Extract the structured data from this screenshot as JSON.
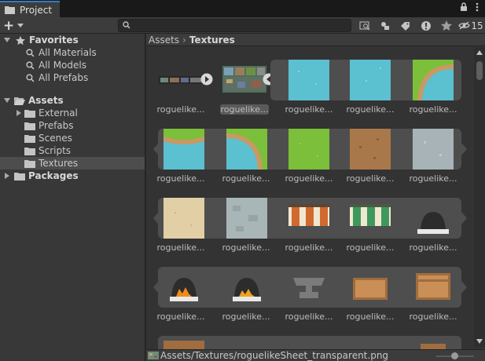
{
  "window": {
    "tab_title": "Project"
  },
  "toolbar": {
    "add_label": "+",
    "search_placeholder": "",
    "hidden_count": "15"
  },
  "tree": {
    "favorites": {
      "label": "Favorites",
      "items": [
        "All Materials",
        "All Models",
        "All Prefabs"
      ]
    },
    "assets": {
      "label": "Assets",
      "items": [
        "External",
        "Prefabs",
        "Scenes",
        "Scripts",
        "Textures"
      ],
      "selected": "Textures"
    },
    "packages": {
      "label": "Packages"
    }
  },
  "breadcrumb": {
    "root": "Assets",
    "current": "Textures"
  },
  "grid": {
    "captions": [
      [
        "roguelike...",
        "roguelike...",
        "roguelike...",
        "roguelike...",
        "roguelike..."
      ],
      [
        "roguelike...",
        "roguelike...",
        "roguelike...",
        "roguelike...",
        "roguelike..."
      ],
      [
        "roguelike...",
        "roguelike...",
        "roguelike...",
        "roguelike...",
        "roguelike..."
      ],
      [
        "roguelike...",
        "roguelike...",
        "roguelike...",
        "roguelike...",
        "roguelike..."
      ]
    ]
  },
  "status": {
    "path": "Assets/Textures/roguelikeSheet_transparent.png"
  },
  "colors": {
    "accent": "#3a79bb",
    "water": "#5bc0d0",
    "grass": "#7bbf3a",
    "dirt": "#a9784a",
    "stone": "#a7b3b6",
    "sand": "#e2cfa6"
  }
}
